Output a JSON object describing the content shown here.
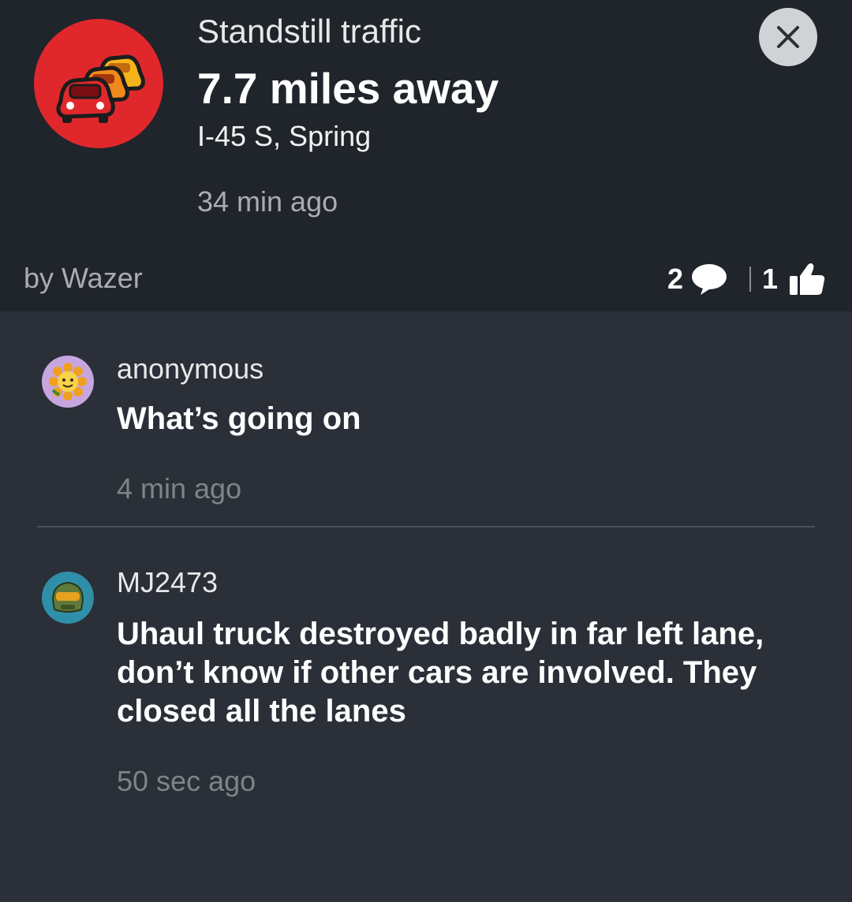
{
  "alert": {
    "type": "Standstill traffic",
    "distance": "7.7 miles away",
    "street": "I-45 S, Spring",
    "time": "34 min ago",
    "reporter": "by Wazer",
    "comment_count": "2",
    "thumbs_up_count": "1",
    "icon": "traffic-jam-cars-icon",
    "icon_color": "#e0282c"
  },
  "comments": [
    {
      "username": "anonymous",
      "text": "What’s going on",
      "time": "4 min ago",
      "avatar": "sunflower-avatar-icon",
      "avatar_color": "#c7a6e0"
    },
    {
      "username": "MJ2473",
      "text": "Uhaul truck destroyed badly in far left lane, don’t know if other cars are involved. They closed all the lanes",
      "time": "50 sec ago",
      "avatar": "helmet-avatar-icon",
      "avatar_color": "#2f8fa8"
    }
  ],
  "colors": {
    "header_bg": "#20242b",
    "body_bg": "#2a2f38",
    "muted_text": "#a9adb3"
  }
}
